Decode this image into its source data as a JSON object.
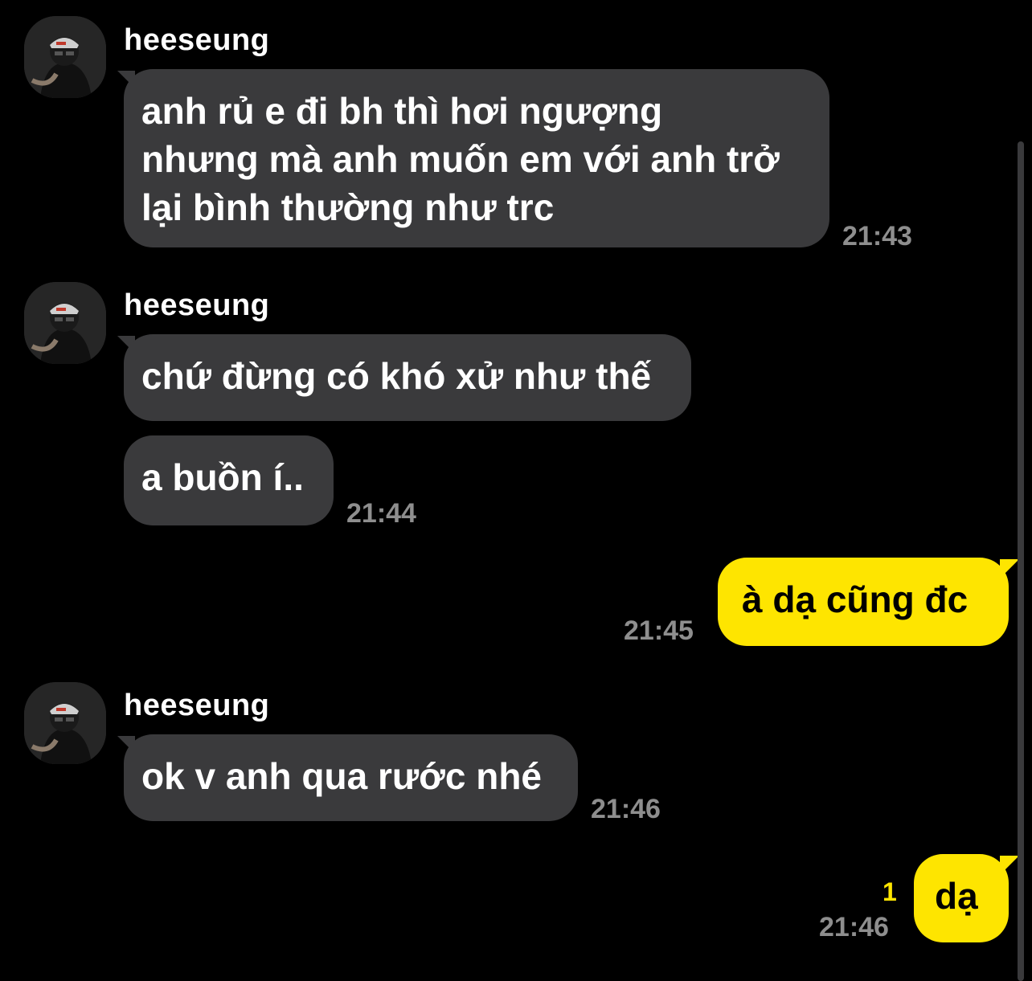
{
  "contact": {
    "name": "heeseung"
  },
  "messages": [
    {
      "lines": [
        "anh rủ e đi bh thì hơi ngượng",
        "nhưng mà anh muốn em với anh trở",
        "lại bình thường như trc"
      ],
      "time": "21:43"
    },
    {
      "text": "chứ đừng có khó xử như thế"
    },
    {
      "text": "a buồn í..",
      "time": "21:44"
    },
    {
      "text": "à dạ cũng đc",
      "time": "21:45"
    },
    {
      "text": "ok v anh qua rước nhé",
      "time": "21:46"
    },
    {
      "text": "dạ",
      "time": "21:46",
      "unread": "1"
    }
  ],
  "colors": {
    "background": "#000000",
    "incoming_bubble": "#3a3a3c",
    "outgoing_bubble": "#fee500",
    "timestamp": "#8e8e8e",
    "unread_count": "#fee500"
  }
}
